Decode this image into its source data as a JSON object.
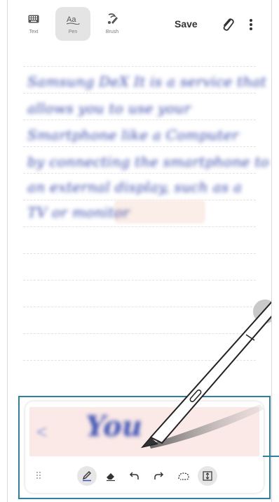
{
  "toolbar": {
    "modes": [
      {
        "label": "Text",
        "icon": "keyboard-icon"
      },
      {
        "label": "Pen",
        "icon": "pen-text-icon"
      },
      {
        "label": "Brush",
        "icon": "brush-icon"
      }
    ],
    "active_mode": "Pen",
    "save_label": "Save",
    "attach_icon": "paperclip-icon",
    "more_icon": "more-vertical-icon"
  },
  "note": {
    "handwriting_lines": [
      "Samsung DeX  It is a service that",
      "allows you to use your",
      "Smartphone  like a Computer",
      "by connecting the smartphone to",
      "an external display, such as a",
      "TV or monitor"
    ]
  },
  "pad": {
    "input_text": "You",
    "tools": [
      "pen-icon",
      "eraser-icon",
      "undo-icon",
      "redo-icon",
      "lasso-icon",
      "insert-space-icon"
    ]
  },
  "colors": {
    "accent": "#2f7f9f",
    "ink": "#3647a8",
    "pad_bg": "#fbe9e7"
  }
}
